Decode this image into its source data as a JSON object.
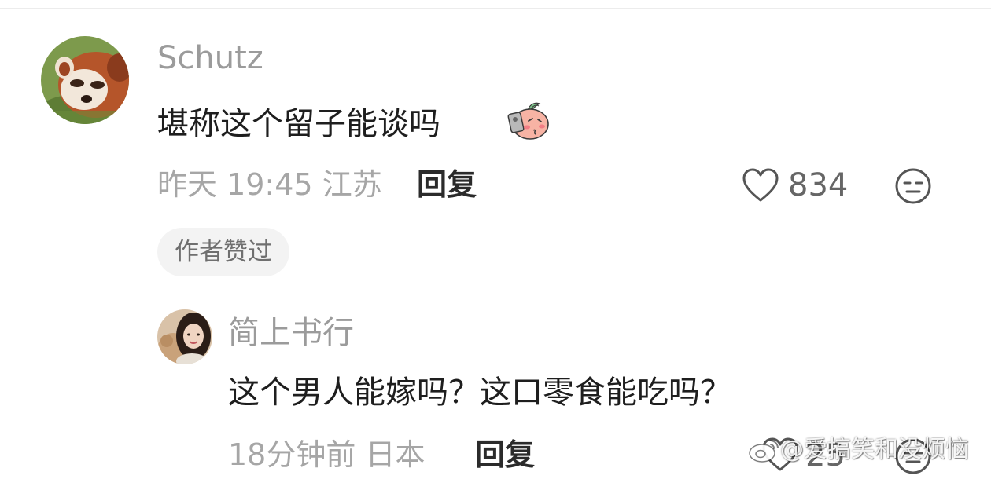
{
  "comment": {
    "username": "Schutz",
    "text": "堪称这个留子能谈吗",
    "emoji_icon": "blushing-peach-emoji-icon",
    "time": "昨天 19:45",
    "location": "江苏",
    "reply_label": "回复",
    "like_count": "834",
    "author_badge": "作者赞过"
  },
  "reply": {
    "username": "简上书行",
    "text": "这个男人能嫁吗？这口零食能吃吗？",
    "time": "18分钟前",
    "location": "日本",
    "reply_label": "回复",
    "like_count": "25"
  },
  "watermark": {
    "text": "@爱搞笑和没烦恼"
  },
  "colors": {
    "username": "#9b9b9b",
    "body_text": "#1e1e1e",
    "meta_text": "#a6a6a6",
    "badge_bg": "#f3f3f3"
  }
}
